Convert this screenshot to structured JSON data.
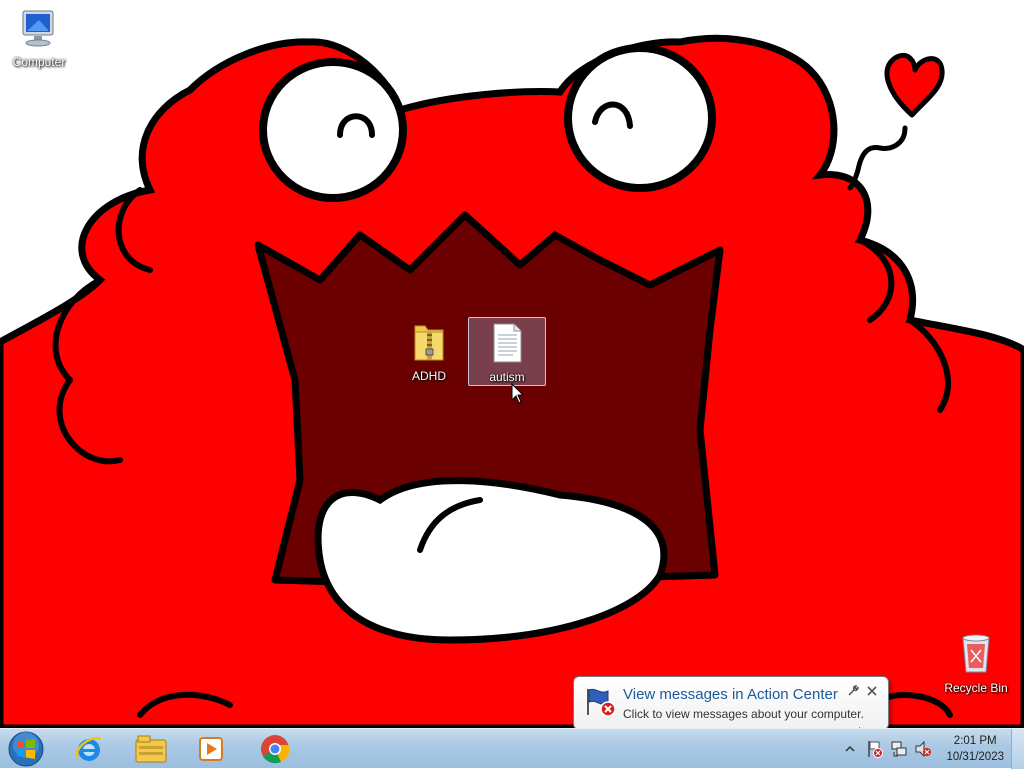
{
  "desktop": {
    "icons": {
      "computer": {
        "label": "Computer"
      },
      "adhd": {
        "label": "ADHD"
      },
      "autism": {
        "label": "autism"
      },
      "recycle_bin": {
        "label": "Recycle Bin"
      }
    },
    "wallpaper_colors": {
      "red": "#ff0000",
      "mouth": "#6a0000",
      "outline": "#000000"
    }
  },
  "notification": {
    "title": "View messages in Action Center",
    "body": "Click to view messages about your computer."
  },
  "taskbar": {
    "pinned": [
      "internet-explorer-icon",
      "windows-explorer-icon",
      "media-player-icon",
      "chrome-icon"
    ],
    "clock": {
      "time": "2:01 PM",
      "date": "10/31/2023"
    },
    "accent": "#a9c8e3"
  }
}
